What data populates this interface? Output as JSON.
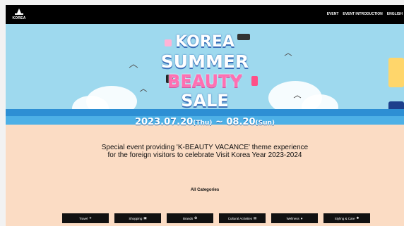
{
  "header": {
    "logo_text": "KOREA",
    "nav": [
      "EVENT",
      "EVENT INTRODUCTION",
      "ENGLISH"
    ]
  },
  "hero": {
    "line1": "KOREA",
    "line2": "SUMMER",
    "line3": "BEAUTY",
    "line4": "SALE",
    "date_main1": "2023.07.20",
    "date_day1": "(Thu)",
    "date_sep": "~",
    "date_main2": "08.20",
    "date_day2": "(Sun)"
  },
  "description": {
    "line1": "Special event providing 'K-BEAUTY VACANCE' theme experience",
    "line2": "for the foreign visitors to celebrate Visit Korea Year 2023-2024"
  },
  "categories": {
    "title": "All Categories",
    "items": [
      {
        "label": "Travel",
        "icon": "plane-icon",
        "glyph": "✈"
      },
      {
        "label": "Shopping",
        "icon": "shopping-bag-icon",
        "glyph": "▣"
      },
      {
        "label": "Brands",
        "icon": "star-icon",
        "glyph": "✪"
      },
      {
        "label": "Cultural Activities",
        "icon": "calendar-icon",
        "glyph": "▤"
      },
      {
        "label": "Wellness",
        "icon": "heart-icon",
        "glyph": "♥"
      },
      {
        "label": "Styling & Care",
        "icon": "sparkle-icon",
        "glyph": "✱"
      }
    ]
  },
  "colors": {
    "sky": "#9ed9ee",
    "sea": "#2d8fd4",
    "sand": "#fbdcc4",
    "accent_pink": "#ff6fb1"
  }
}
